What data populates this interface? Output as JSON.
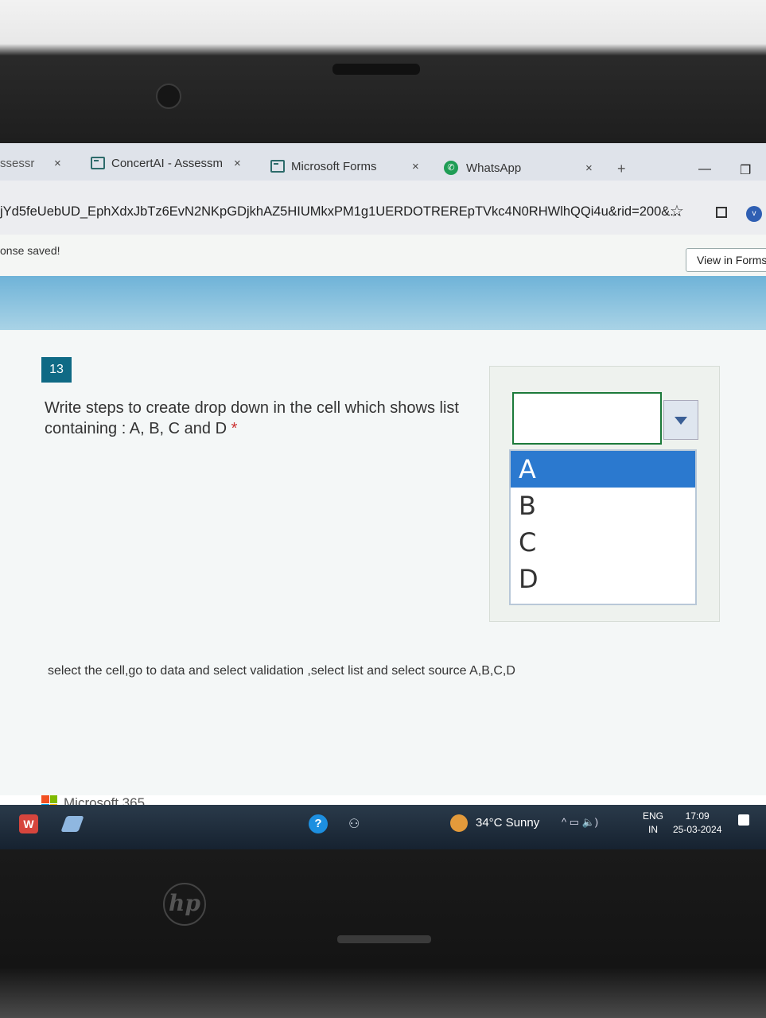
{
  "browser": {
    "tabs": [
      {
        "label": "ssessr",
        "close": "×"
      },
      {
        "label": "ConcertAI - Assessm",
        "close": "×"
      },
      {
        "label": "Microsoft Forms",
        "close": "×"
      },
      {
        "label": "WhatsApp",
        "close": "×"
      }
    ],
    "new_tab": "+",
    "minimize": "—",
    "restore": "❐",
    "url": "jYd5feUebUD_EphXdxJbTz6EvN2NKpGDjkhAZ5HIUMkxPM1g1UERDOTREREpTVkc4N0RHWlhQQi4u&rid=200&...",
    "star": "☆",
    "profile": "v"
  },
  "forms": {
    "status": "onse saved!",
    "view_in_forms": "View in Forms"
  },
  "question": {
    "number": "13",
    "text": "Write steps to create drop down in the cell which shows list containing : A, B, C and D",
    "required_mark": " *",
    "answer": "select the cell,go to data and select validation ,select list and  select source A,B,C,D"
  },
  "dropdown_illustration": {
    "options": [
      "A",
      "B",
      "C",
      "D"
    ],
    "selected": "A"
  },
  "footer": {
    "brand": "Microsoft 365"
  },
  "taskbar": {
    "app_w": "W",
    "help": "?",
    "weather": "34°C  Sunny",
    "tray": "^  ▭  🔈)  ",
    "lang_top": "ENG",
    "lang_bottom": "IN",
    "time": "17:09",
    "date": "25-03-2024"
  },
  "device": {
    "logo": "hp"
  }
}
